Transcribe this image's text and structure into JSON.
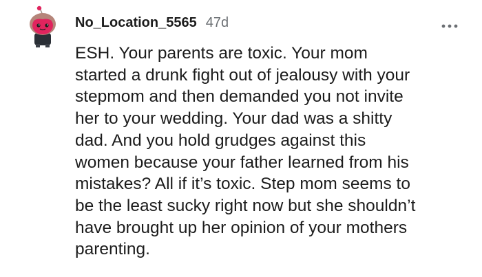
{
  "comment": {
    "username": "No_Location_5565",
    "age": "47d",
    "text": "ESH. Your parents are toxic. Your mom\nstarted a drunk fight out of jealousy with your\nstepmom and then demanded you not invite\nher to your wedding. Your dad was a shitty\ndad. And you hold grudges against this\nwomen because your father learned from his\nmistakes? All if it’s toxic. Step mom seems to\nbe the least sucky right now but she shouldn’t\nhave brought up her opinion of your mothers\nparenting.",
    "avatar_icon": "snoo-avatar-icon",
    "menu_icon": "more-options-icon"
  },
  "colors": {
    "username": "#1c1c1c",
    "age": "#6b6f73",
    "text": "#1c1c1c",
    "avatar_face": "#e0245e",
    "avatar_hair": "#b5857a",
    "avatar_body": "#2a2f36"
  }
}
